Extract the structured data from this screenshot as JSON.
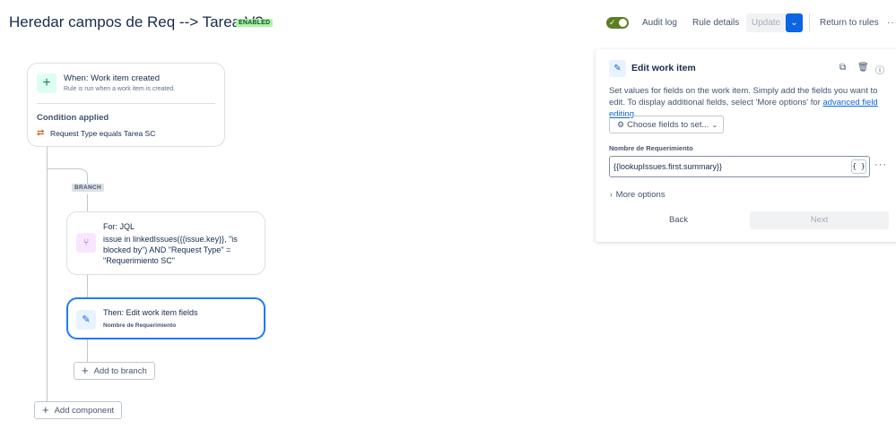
{
  "header": {
    "title": "Heredar campos de Req --> Tarea V2",
    "status_badge": "ENABLED",
    "toggle_state": "on",
    "audit_log": "Audit log",
    "rule_details": "Rule details",
    "update": "Update",
    "return_to_rules": "Return to rules",
    "more_icon": "more-horizontal-icon"
  },
  "canvas": {
    "trigger": {
      "icon": "plus-icon",
      "title": "When: Work item created",
      "subtitle": "Rule is run when a work item is created.",
      "condition_title": "Condition applied",
      "condition_icon": "swap-icon",
      "condition_text": "Request Type equals Tarea SC"
    },
    "branch_tag": "BRANCH",
    "for_node": {
      "icon": "branch-icon",
      "title": "For: JQL",
      "query_lines": [
        "issue in linkedIssues({{issue.key}}, \"is",
        "blocked by\") AND \"Request Type\" =",
        "\"Requerimiento SC\""
      ]
    },
    "then_node": {
      "icon": "edit-icon",
      "title": "Then: Edit work item fields",
      "subtitle": "Nombre de Requerimiento"
    },
    "add_to_branch": "Add to branch",
    "add_component": "Add component"
  },
  "panel": {
    "icon": "edit-icon",
    "title": "Edit work item",
    "tools": [
      "copy-icon",
      "trash-icon",
      "help-icon"
    ],
    "description_text": "Set values for fields on the work item. Simply add the fields you want to edit. To display additional fields, select 'More options' for ",
    "description_link": "advanced field editing",
    "description_end": ".",
    "choose_fields": "Choose fields to set...",
    "field_label": "Nombre de Requerimiento",
    "field_value": "{{lookupIssues.first.summary}}",
    "field_braces": "{ }",
    "more_options": "More options",
    "back": "Back",
    "next": "Next"
  },
  "colors": {
    "accent": "#0c66e4",
    "badge_bg": "#abf5a1",
    "toggle_on": "#5b7f24",
    "selected_border": "#1d7afc"
  }
}
